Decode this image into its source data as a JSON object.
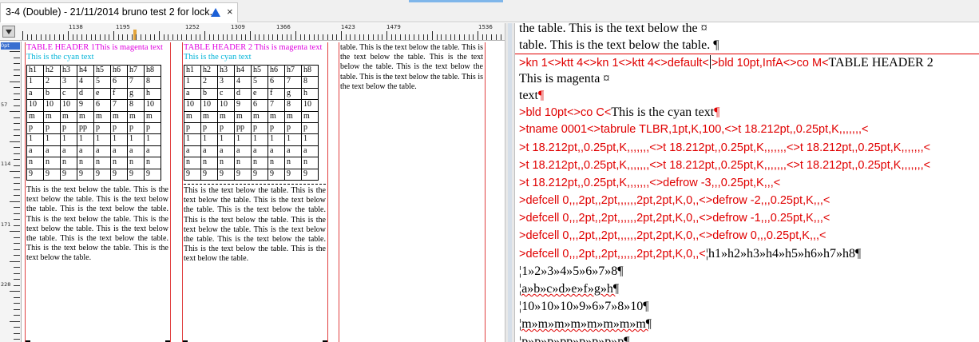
{
  "tab": {
    "title": "3-4 (Double) - 21/11/2014 bruno test 2 for lock...",
    "close_glyph": "×"
  },
  "ruler": {
    "horizontal_labels": [
      "1138",
      "1195",
      "1252",
      "1309",
      "1366",
      "1423",
      "1479",
      "1536"
    ],
    "vertical_labels": [
      "0pt",
      "57",
      "114",
      "171",
      "228"
    ]
  },
  "galley": {
    "col1": {
      "header": "TABLE HEADER 1This is magenta text",
      "cyan_text": "This is the cyan text"
    },
    "col2": {
      "header": "TABLE HEADER 2 This is magenta text",
      "cyan_text": "This is the cyan text"
    },
    "table_rows": [
      [
        "h1",
        "h2",
        "h3",
        "h4",
        "h5",
        "h6",
        "h7",
        "h8"
      ],
      [
        "1",
        "2",
        "3",
        "4",
        "5",
        "6",
        "7",
        "8"
      ],
      [
        "a",
        "b",
        "c",
        "d",
        "e",
        "f",
        "g",
        "h"
      ],
      [
        "10",
        "10",
        "10",
        "9",
        "6",
        "7",
        "8",
        "10"
      ],
      [
        "m",
        "m",
        "m",
        "m",
        "m",
        "m",
        "m",
        "m"
      ],
      [
        "p",
        "p",
        "p",
        "pp",
        "p",
        "p",
        "p",
        "p"
      ],
      [
        "1",
        "1",
        "1",
        "1",
        "1",
        "1",
        "1",
        "1"
      ],
      [
        "a",
        "a",
        "a",
        "a",
        "a",
        "a",
        "a",
        "a"
      ],
      [
        "n",
        "n",
        "n",
        "n",
        "n",
        "n",
        "n",
        "n"
      ],
      [
        "9",
        "9",
        "9",
        "9",
        "9",
        "9",
        "9",
        "9"
      ]
    ],
    "below_text": "This is the text below the table. This is the text below the table. This is the text below the table. This is the text below the table. This is the text below the table. This is the text below the table. This is the text below the table. This is the text below the table. This is the text below the table. This is the text below the table.",
    "col3_text": "table. This is the text below the table. This is the text below the table. This is the text below the table. This is the text below the table. This is the text below the table. This is the text below the table."
  },
  "source": {
    "line1": "the table. This is the text below the ¤",
    "line2": "table. This is the text below the table. ¶",
    "line3_red": ">kn 1<>ktt 4<>kn 1<>ktt 4<>default<",
    "line3_red2": ">bld 10pt,InfA<>co M<",
    "line3_black": "TABLE HEADER 2",
    "line4": "This is magenta ¤",
    "line5": "text",
    "line5_pilcrow": "¶",
    "line6_red": ">bld 10pt<>co C<",
    "line6_black": "This is the cyan text",
    "line6_pilcrow": "¶",
    "line7": ">tname 0001<>tabrule TLBR,1pt,K,100,<>t 18.212pt,,0.25pt,K,,,,,,,<",
    "line8": ">t 18.212pt,,0.25pt,K,,,,,,,<>t 18.212pt,,0.25pt,K,,,,,,,<>t 18.212pt,,0.25pt,K,,,,,,,<",
    "line9": ">t 18.212pt,,0.25pt,K,,,,,,,<>t 18.212pt,,0.25pt,K,,,,,,,<>t 18.212pt,,0.25pt,K,,,,,,,<",
    "line10": ">t 18.212pt,,0.25pt,K,,,,,,,<>defrow -3,,,0.25pt,K,,,<",
    "line11": ">defcell 0,,,2pt,,2pt,,,,,,2pt,2pt,K,0,,<>defrow -2,,,0.25pt,K,,,<",
    "line12": ">defcell 0,,,2pt,,2pt,,,,,,2pt,2pt,K,0,,<>defrow -1,,,0.25pt,K,,,<",
    "line13": ">defcell 0,,,2pt,,2pt,,,,,,2pt,2pt,K,0,,<>defrow 0,,,0.25pt,K,,,<",
    "line14_red": ">defcell 0,,,2pt,,2pt,,,,,,2pt,2pt,K,0,,<",
    "line14_black": "¦h1»h2»h3»h4»h5»h6»h7»h8¶",
    "line15": "¦1»2»3»4»5»6»7»8¶",
    "line16": "¦a»b»c»d»e»f»g»h¶",
    "line17": "¦10»10»10»9»6»7»8»10¶",
    "line18": "¦m»m»m»m»m»m»m»m¶",
    "line19": "¦p»p»p»pp»p»p»p»p¶"
  },
  "colors": {
    "magenta": "#e000e0",
    "cyan": "#00b4d8",
    "code_red": "#e00000",
    "column_border": "#e04040",
    "tab_triangle": "#1a5fd6"
  }
}
